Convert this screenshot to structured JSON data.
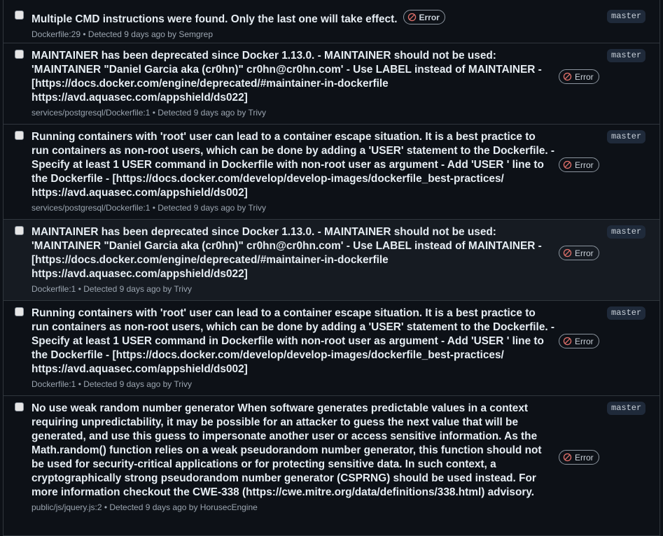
{
  "error_badge_label": "Error",
  "alerts": [
    {
      "title": "Multiple CMD instructions were found. Only the last one will take effect.",
      "meta": "Dockerfile:29 • Detected 9 days ago by Semgrep",
      "branch": "master",
      "severity": "Error"
    },
    {
      "title": "MAINTAINER has been deprecated since Docker 1.13.0. - MAINTAINER should not be used: 'MAINTAINER \"Daniel Garcia aka (cr0hn)\" cr0hn@cr0hn.com' - Use LABEL instead of MAINTAINER - [https://docs.docker.com/engine/deprecated/#maintainer-in-dockerfile https://avd.aquasec.com/appshield/ds022]",
      "meta": "services/postgresql/Dockerfile:1 • Detected 9 days ago by Trivy",
      "branch": "master",
      "severity": "Error"
    },
    {
      "title": "Running containers with 'root' user can lead to a container escape situation. It is a best practice to run containers as non-root users, which can be done by adding a 'USER' statement to the Dockerfile. - Specify at least 1 USER command in Dockerfile with non-root user as argument - Add 'USER ' line to the Dockerfile - [https://docs.docker.com/develop/develop-images/dockerfile_best-practices/ https://avd.aquasec.com/appshield/ds002]",
      "meta": "services/postgresql/Dockerfile:1 • Detected 9 days ago by Trivy",
      "branch": "master",
      "severity": "Error"
    },
    {
      "title": "MAINTAINER has been deprecated since Docker 1.13.0. - MAINTAINER should not be used: 'MAINTAINER \"Daniel Garcia aka (cr0hn)\" cr0hn@cr0hn.com' - Use LABEL instead of MAINTAINER - [https://docs.docker.com/engine/deprecated/#maintainer-in-dockerfile https://avd.aquasec.com/appshield/ds022]",
      "meta": "Dockerfile:1 • Detected 9 days ago by Trivy",
      "branch": "master",
      "severity": "Error"
    },
    {
      "title": "Running containers with 'root' user can lead to a container escape situation. It is a best practice to run containers as non-root users, which can be done by adding a 'USER' statement to the Dockerfile. - Specify at least 1 USER command in Dockerfile with non-root user as argument - Add 'USER ' line to the Dockerfile - [https://docs.docker.com/develop/develop-images/dockerfile_best-practices/ https://avd.aquasec.com/appshield/ds002]",
      "meta": "Dockerfile:1 • Detected 9 days ago by Trivy",
      "branch": "master",
      "severity": "Error"
    },
    {
      "title": "No use weak random number generator When software generates predictable values in a context requiring unpredictability, it may be possible for an attacker to guess the next value that will be generated, and use this guess to impersonate another user or access sensitive information. As the Math.random() function relies on a weak pseudorandom number generator, this function should not be used for security-critical applications or for protecting sensitive data. In such context, a cryptographically strong pseudorandom number generator (CSPRNG) should be used instead. For more information checkout the CWE-338 (https://cwe.mitre.org/data/definitions/338.html) advisory.",
      "meta": "public/js/jquery.js:2 • Detected 9 days ago by HorusecEngine",
      "branch": "master",
      "severity": "Error"
    }
  ]
}
